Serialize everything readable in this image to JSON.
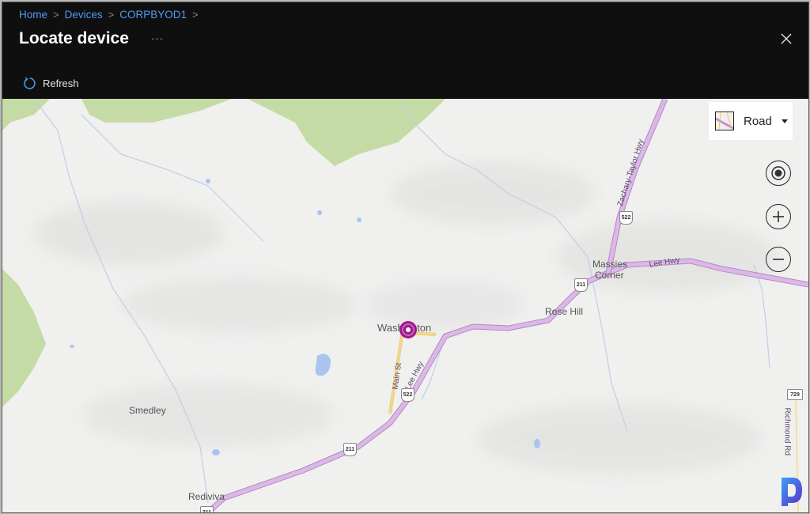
{
  "breadcrumb": [
    {
      "label": "Home"
    },
    {
      "label": "Devices"
    },
    {
      "label": "CORPBYOD1"
    }
  ],
  "page": {
    "title": "Locate device",
    "more_label": "···"
  },
  "toolbar": {
    "refresh_label": "Refresh"
  },
  "map": {
    "style_picker": {
      "selected": "Road"
    },
    "places": {
      "washington": "Washington",
      "massies_corner_1": "Massies",
      "massies_corner_2": "Corner",
      "rose_hill": "Rose Hill",
      "smedley": "Smedley",
      "rediviva": "Rediviva"
    },
    "roads": {
      "lee_hwy_1": "Lee Hwy",
      "lee_hwy_2": "Lee Hwy",
      "zachary_taylor_hwy": "Zachary-Taylor Hwy",
      "main_st": "Main St",
      "richmond_rd": "Richmond Rd"
    },
    "shields": {
      "us522_north": "522",
      "us522_south": "522",
      "us211_east": "211",
      "us211_west": "211",
      "us211_bottom": "211",
      "va729": "729"
    },
    "colors": {
      "highway": "#dcb8e8",
      "highway_edge": "#b08ac0",
      "local_road": "#f5d98a",
      "forest": "#c5dba5",
      "water": "#a9c4ee",
      "pin": "#a0188f"
    }
  }
}
